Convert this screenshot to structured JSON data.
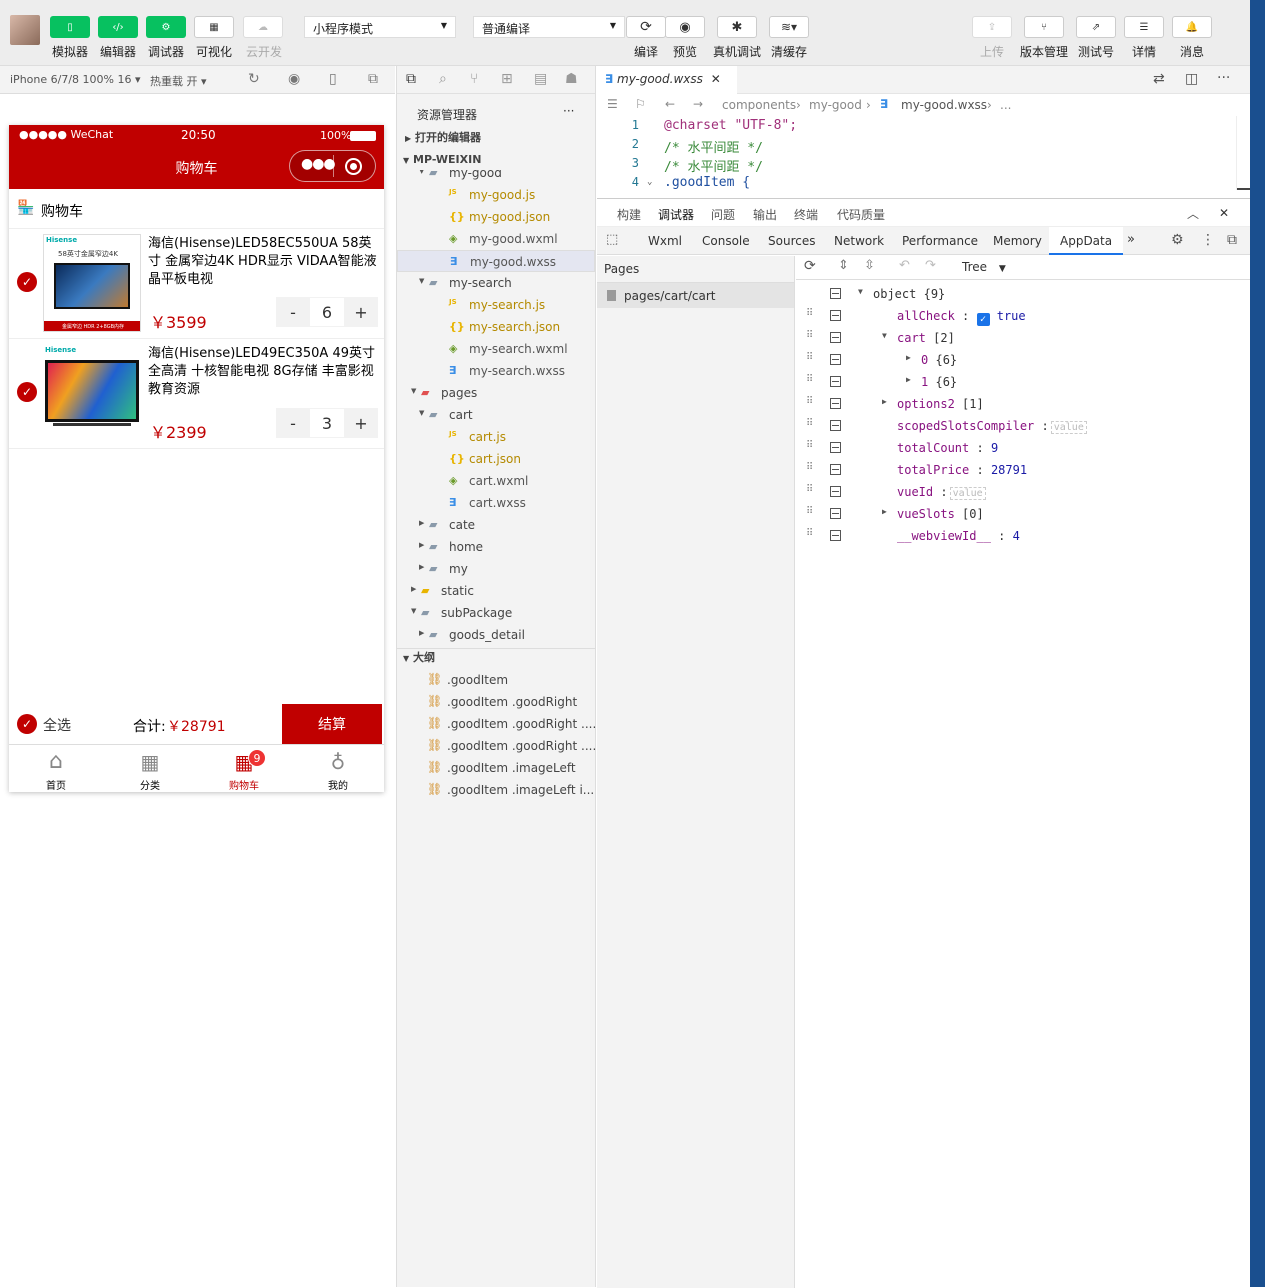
{
  "toolbar": {
    "buttons": [
      {
        "label": "模拟器"
      },
      {
        "label": "编辑器"
      },
      {
        "label": "调试器"
      },
      {
        "label": "可视化"
      },
      {
        "label": "云开发"
      }
    ],
    "mode_select": "小程序模式",
    "compile_select": "普通编译",
    "actions": [
      {
        "label": "编译"
      },
      {
        "label": "预览"
      },
      {
        "label": "真机调试"
      },
      {
        "label": "清缓存"
      }
    ],
    "right_actions": [
      {
        "label": "上传"
      },
      {
        "label": "版本管理"
      },
      {
        "label": "测试号"
      },
      {
        "label": "详情"
      },
      {
        "label": "消息"
      }
    ]
  },
  "simbar": {
    "device": "iPhone 6/7/8 100% 16",
    "hot_reload": "热重载 开"
  },
  "phone": {
    "status": {
      "carrier": "●●●●● WeChat",
      "time": "20:50",
      "battery": "100%"
    },
    "nav_title": "购物车",
    "cart_header": "购物车",
    "items": [
      {
        "title": "海信(Hisense)LED58EC550UA 58英寸 金属窄边4K HDR显示 VIDAA智能液晶平板电视",
        "price": "￥3599",
        "count": "6",
        "img_brand": "Hisense",
        "img_caption": "58英寸金属窄边4K",
        "img_footer": "金属窄边 HDR 2+8GB内存"
      },
      {
        "title": "海信(Hisense)LED49EC350A 49英寸全高清 十核智能电视 8G存储 丰富影视教育资源",
        "price": "￥2399",
        "count": "3",
        "img_brand": "Hisense"
      }
    ],
    "stepper_minus": "-",
    "stepper_plus": "+",
    "select_all": "全选",
    "total_label": "合计:",
    "total_value": "￥28791",
    "checkout": "结算",
    "tabs": [
      {
        "label": "首页"
      },
      {
        "label": "分类"
      },
      {
        "label": "购物车",
        "badge": "9"
      },
      {
        "label": "我的"
      }
    ]
  },
  "explorer": {
    "title": "资源管理器",
    "more": "···",
    "open_editors": "打开的编辑器",
    "project": "MP-WEIXIN",
    "tree": [
      {
        "label": "my-good",
        "type": "folder-open"
      },
      {
        "label": "my-good.js",
        "type": "js"
      },
      {
        "label": "my-good.json",
        "type": "json"
      },
      {
        "label": "my-good.wxml",
        "type": "wxml"
      },
      {
        "label": "my-good.wxss",
        "type": "wxss",
        "selected": true
      },
      {
        "label": "my-search",
        "type": "folder-open"
      },
      {
        "label": "my-search.js",
        "type": "js"
      },
      {
        "label": "my-search.json",
        "type": "json"
      },
      {
        "label": "my-search.wxml",
        "type": "wxml"
      },
      {
        "label": "my-search.wxss",
        "type": "wxss"
      },
      {
        "label": "pages",
        "type": "folder-open-red"
      },
      {
        "label": "cart",
        "type": "folder-open"
      },
      {
        "label": "cart.js",
        "type": "js"
      },
      {
        "label": "cart.json",
        "type": "json"
      },
      {
        "label": "cart.wxml",
        "type": "wxml"
      },
      {
        "label": "cart.wxss",
        "type": "wxss"
      },
      {
        "label": "cate",
        "type": "folder"
      },
      {
        "label": "home",
        "type": "folder"
      },
      {
        "label": "my",
        "type": "folder"
      },
      {
        "label": "static",
        "type": "folder-yellow"
      },
      {
        "label": "subPackage",
        "type": "folder-open"
      },
      {
        "label": "goods_detail",
        "type": "folder"
      }
    ],
    "outline_title": "大纲",
    "outline": [
      {
        "label": ".goodItem"
      },
      {
        "label": ".goodItem .goodRight"
      },
      {
        "label": ".goodItem .goodRight ...."
      },
      {
        "label": ".goodItem .goodRight ...."
      },
      {
        "label": ".goodItem .imageLeft"
      },
      {
        "label": ".goodItem .imageLeft i..."
      }
    ]
  },
  "editor": {
    "tab": "my-good.wxss",
    "breadcrumb": [
      "components",
      "my-good",
      "my-good.wxss",
      "..."
    ],
    "lines": [
      {
        "num": "1",
        "code": "@charset \"UTF-8\";"
      },
      {
        "num": "2",
        "code": "/* 水平间距 */"
      },
      {
        "num": "3",
        "code": "/* 水平间距 */"
      },
      {
        "num": "4",
        "code": ".goodItem {"
      }
    ]
  },
  "devtools": {
    "top_tabs": [
      "构建",
      "调试器",
      "问题",
      "输出",
      "终端",
      "代码质量"
    ],
    "panel_tabs": [
      "Wxml",
      "Console",
      "Sources",
      "Network",
      "Performance",
      "Memory",
      "AppData"
    ],
    "pages_title": "Pages",
    "page_entry": "pages/cart/cart",
    "view_mode": "Tree",
    "data": [
      {
        "key": "object",
        "val": "{9}",
        "indent": 0,
        "arrow": "down"
      },
      {
        "key": "allCheck",
        "val": "true",
        "indent": 1,
        "checkbox": true
      },
      {
        "key": "cart",
        "val": "[2]",
        "indent": 1,
        "arrow": "down"
      },
      {
        "key": "0",
        "val": "{6}",
        "indent": 2,
        "arrow": "right"
      },
      {
        "key": "1",
        "val": "{6}",
        "indent": 2,
        "arrow": "right"
      },
      {
        "key": "options2",
        "val": "[1]",
        "indent": 1,
        "arrow": "right"
      },
      {
        "key": "scopedSlotsCompiler",
        "val": "value",
        "indent": 1,
        "placeholder": true
      },
      {
        "key": "totalCount",
        "val": "9",
        "indent": 1
      },
      {
        "key": "totalPrice",
        "val": "28791",
        "indent": 1
      },
      {
        "key": "vueId",
        "val": "value",
        "indent": 1,
        "placeholder": true
      },
      {
        "key": "vueSlots",
        "val": "[0]",
        "indent": 1,
        "arrow": "right"
      },
      {
        "key": "__webviewId__",
        "val": "4",
        "indent": 1
      }
    ]
  },
  "colors": {
    "accent": "#c00000",
    "green": "#07c160",
    "link": "#1a73e8"
  }
}
